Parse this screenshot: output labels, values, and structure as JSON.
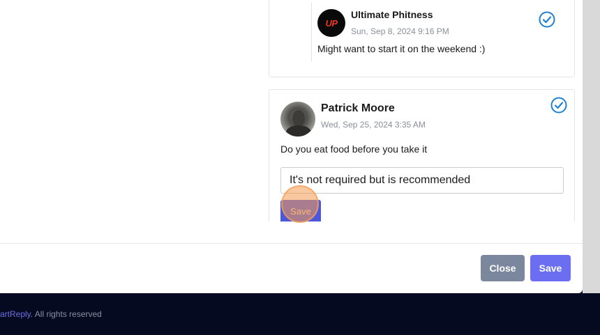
{
  "comments": [
    {
      "author": "Ultimate Phitness",
      "avatar_text": "UP",
      "date": "Sun, Sep 8, 2024 9:16 PM",
      "message": "Might want to start it on the weekend :)"
    },
    {
      "author": "Patrick Moore",
      "date": "Wed, Sep 25, 2024 3:35 AM",
      "message": "Do you eat food before you take it",
      "reply_value": "It's not required but is recommended",
      "reply_save_label": "Save"
    }
  ],
  "modal": {
    "close_label": "Close",
    "save_label": "Save"
  },
  "footer": {
    "brand": "artReply",
    "rights": ". All rights reserved"
  },
  "icons": {
    "check": "check-circle-icon",
    "check_color": "#1f7fd1",
    "accent": "#6b6ef0"
  }
}
